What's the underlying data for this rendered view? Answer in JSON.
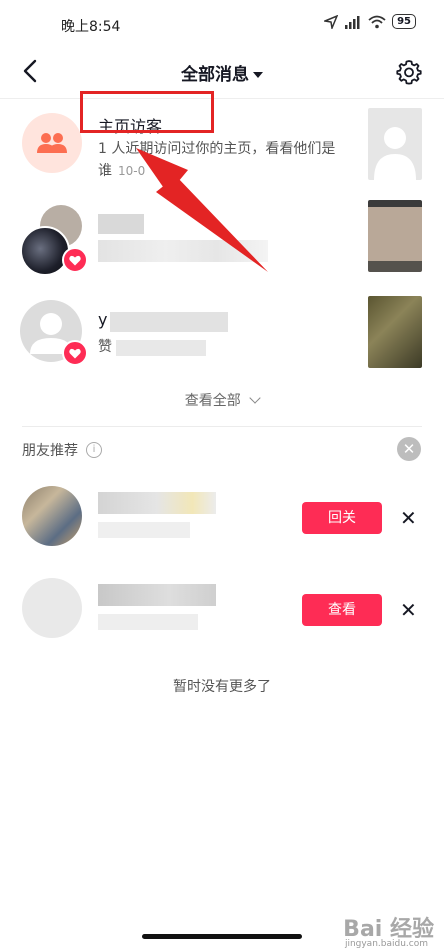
{
  "status_bar": {
    "time": "晚上8:54",
    "battery": "95"
  },
  "header": {
    "title": "全部消息"
  },
  "messages": [
    {
      "title": "主页访客",
      "subtitle_line1": "1 人近期访问过你的主页，看看他们是",
      "subtitle_line2": "谁",
      "time": "10-0"
    },
    {
      "title": "",
      "subtitle": ""
    },
    {
      "title": "y",
      "subtitle": "赞"
    }
  ],
  "see_all": {
    "label": "查看全部"
  },
  "friends": {
    "label": "朋友推荐",
    "items": [
      {
        "action_label": "回关"
      },
      {
        "action_label": "查看"
      }
    ]
  },
  "footer": {
    "no_more": "暂时没有更多了"
  },
  "watermark": {
    "text": "Bai 经验",
    "sub": "jingyan.baidu.com"
  },
  "colors": {
    "accent": "#fe2c55",
    "annotation": "#e32424"
  }
}
